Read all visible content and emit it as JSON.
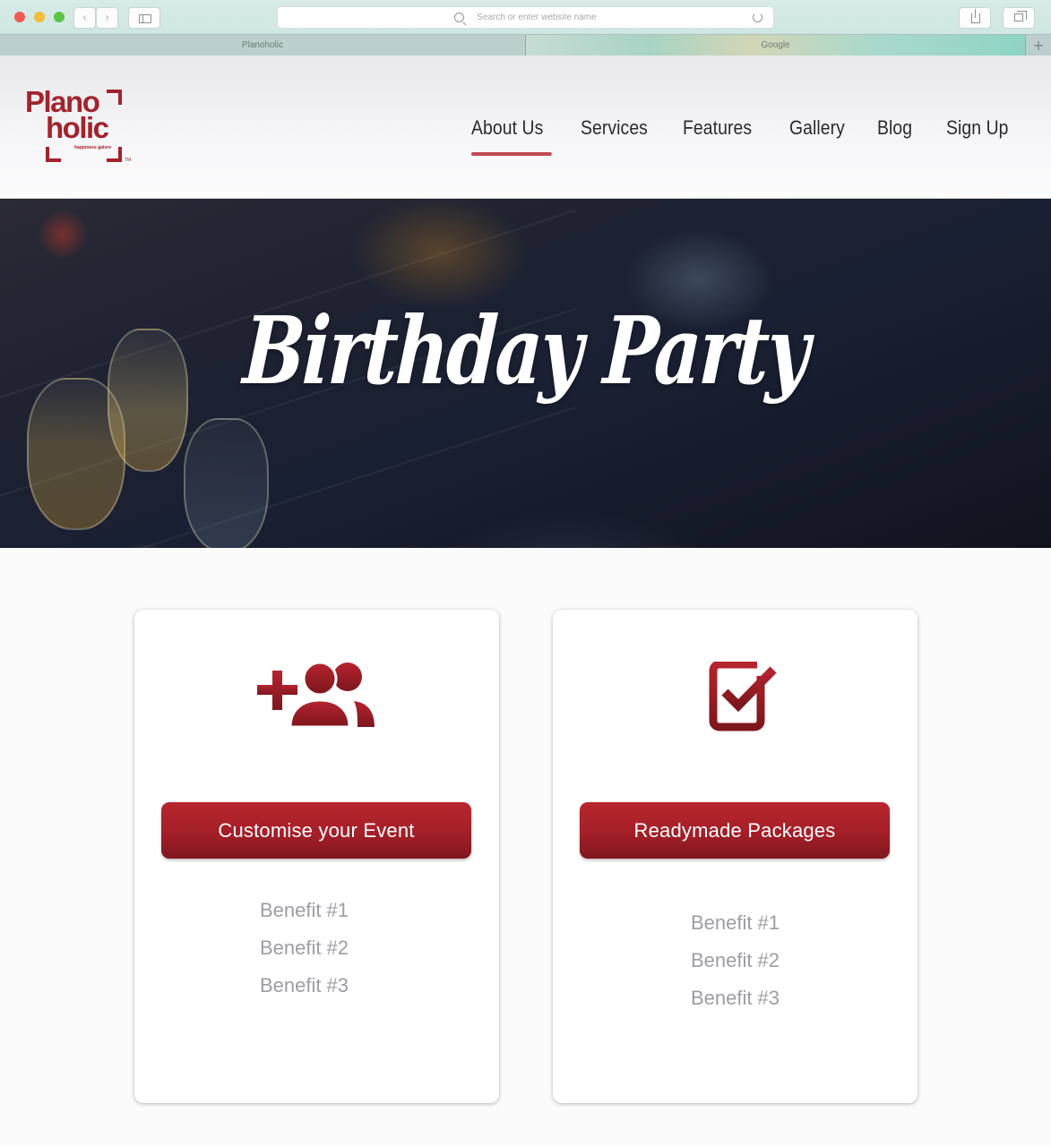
{
  "browser": {
    "address_placeholder": "Search or enter website name",
    "tabs": [
      {
        "label": "Planoholic"
      },
      {
        "label": "Google"
      }
    ],
    "new_tab_label": "+"
  },
  "site": {
    "logo": {
      "line1": "Plano",
      "line2": "holic",
      "tagline": "happiness galore",
      "trademark": "TM"
    },
    "nav": [
      {
        "label": "About Us",
        "active": true
      },
      {
        "label": "Services"
      },
      {
        "label": "Features"
      },
      {
        "label": "Gallery"
      },
      {
        "label": "Blog"
      },
      {
        "label": "Sign Up"
      }
    ]
  },
  "hero": {
    "title": "Birthday Party"
  },
  "cards": [
    {
      "icon": "add-group-icon",
      "button_label": "Customise your Event",
      "benefits": [
        "Benefit #1",
        "Benefit #2",
        "Benefit #3"
      ]
    },
    {
      "icon": "checkbox-checked-icon",
      "button_label": "Readymade Packages",
      "benefits": [
        "Benefit #1",
        "Benefit #2",
        "Benefit #3"
      ]
    }
  ],
  "colors": {
    "brand_red": "#a3232d",
    "nav_underline": "#c04a51",
    "benefit_text": "#9d9da3"
  }
}
